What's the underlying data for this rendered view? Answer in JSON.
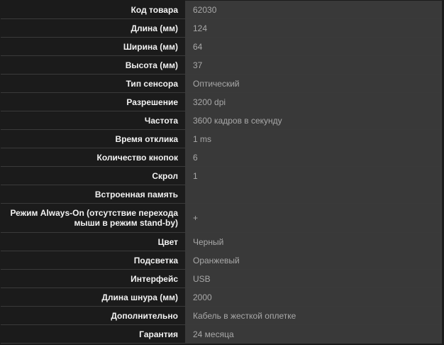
{
  "specs": [
    {
      "label": "Код товара",
      "value": "62030"
    },
    {
      "label": "Длина (мм)",
      "value": "124"
    },
    {
      "label": "Ширина (мм)",
      "value": "64"
    },
    {
      "label": "Высота (мм)",
      "value": "37"
    },
    {
      "label": "Тип сенсора",
      "value": "Оптический"
    },
    {
      "label": "Разрешение",
      "value": "3200 dpi"
    },
    {
      "label": "Частота",
      "value": "3600 кадров в секунду"
    },
    {
      "label": "Время отклика",
      "value": "1 ms"
    },
    {
      "label": "Количество кнопок",
      "value": "6"
    },
    {
      "label": "Скрол",
      "value": "1"
    },
    {
      "label": "Встроенная память",
      "value": ""
    },
    {
      "label": "Режим Always-On (отсутствие перехода мыши в режим stand-by)",
      "value": "+"
    },
    {
      "label": "Цвет",
      "value": "Черный"
    },
    {
      "label": "Подсветка",
      "value": "Оранжевый"
    },
    {
      "label": "Интерфейс",
      "value": "USB"
    },
    {
      "label": "Длина шнура (мм)",
      "value": "2000"
    },
    {
      "label": "Дополнительно",
      "value": "Кабель в жесткой оплетке"
    },
    {
      "label": "Гарантия",
      "value": "24 месяца"
    }
  ]
}
